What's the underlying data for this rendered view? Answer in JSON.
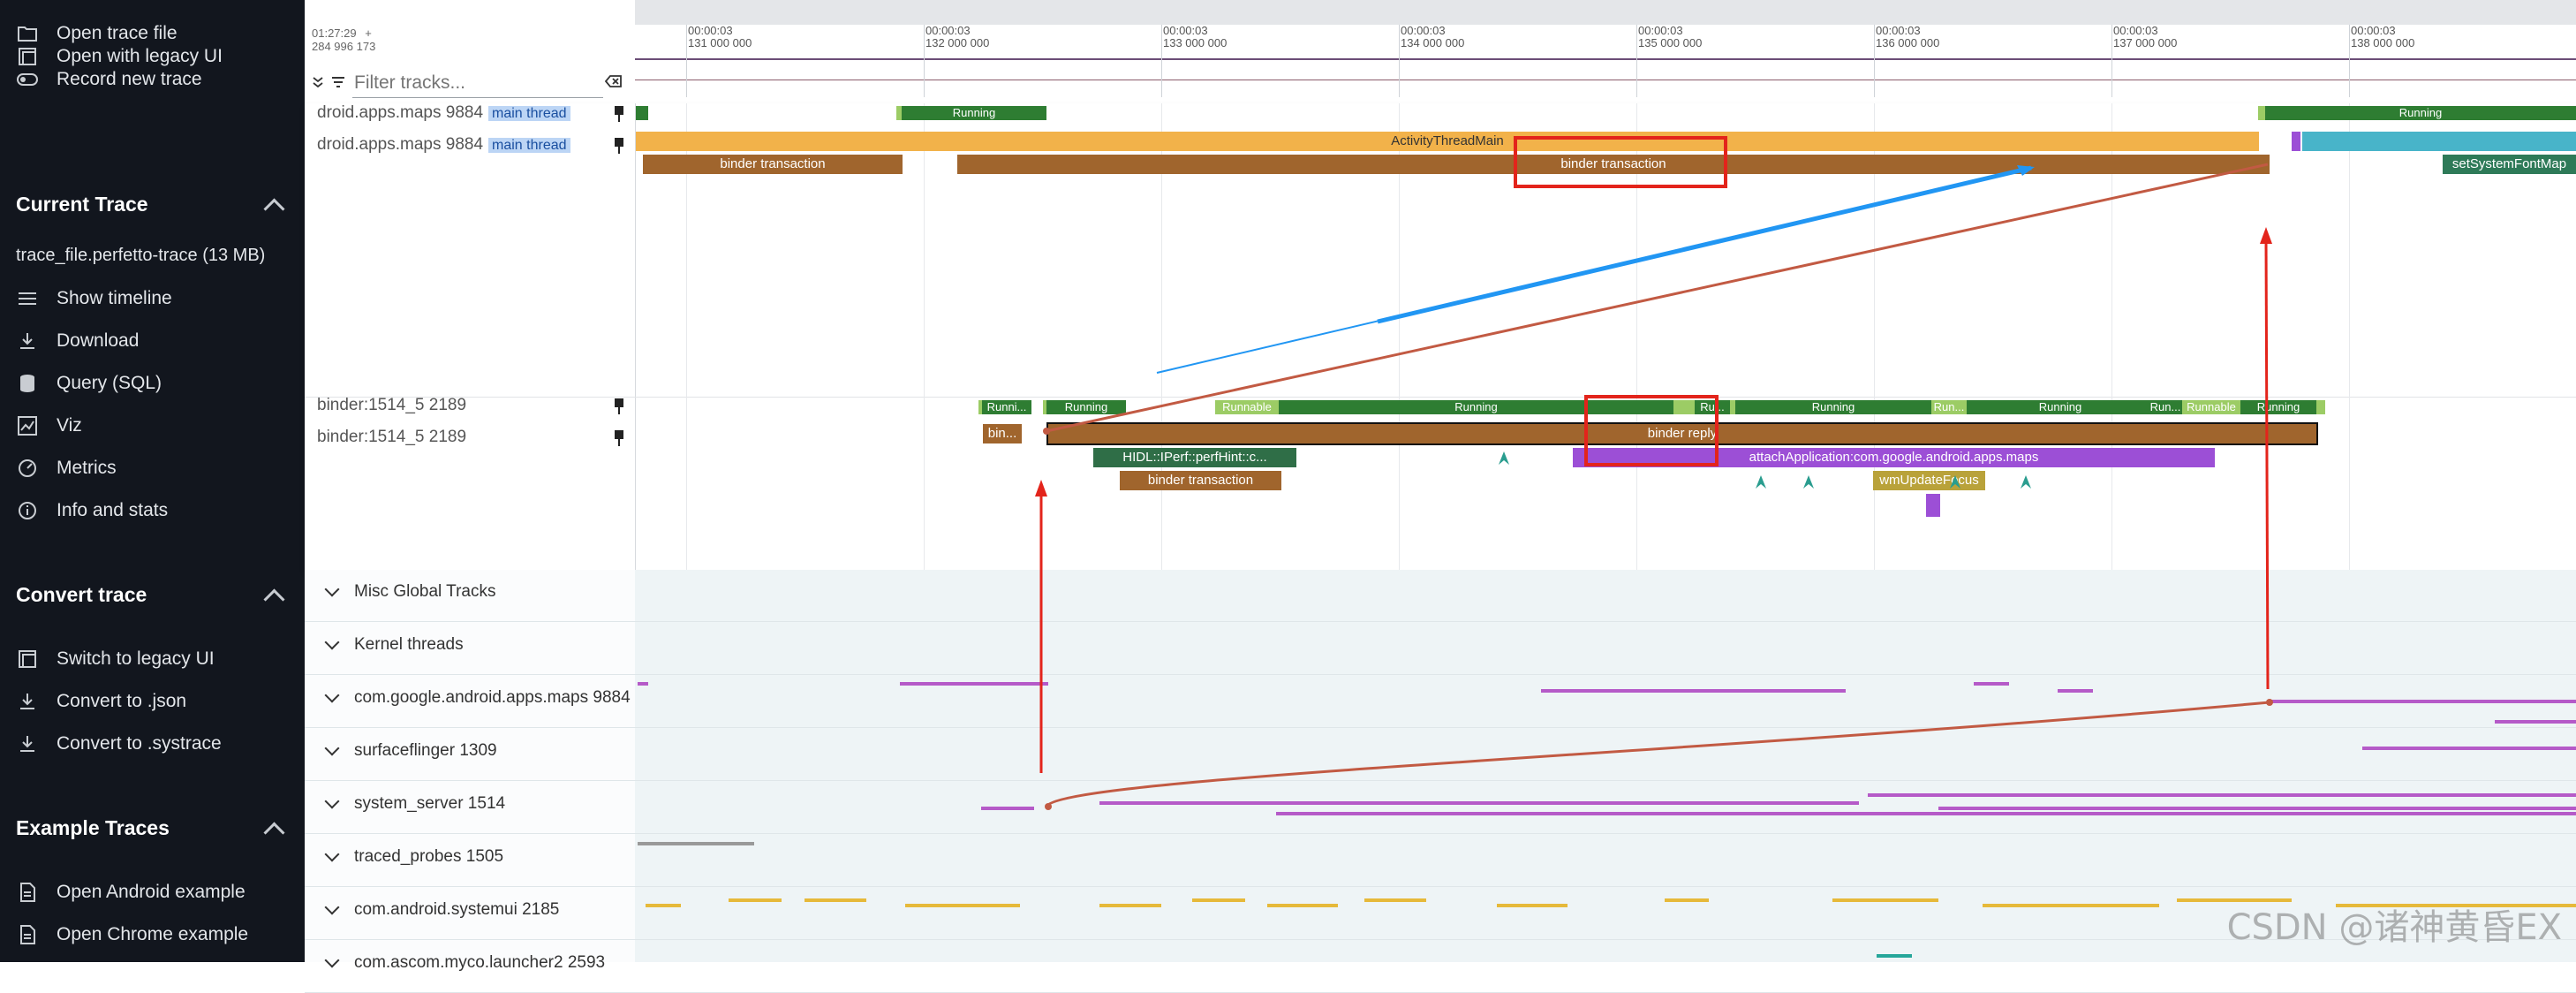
{
  "sidebar": {
    "top_items": [
      {
        "label": "Open trace file",
        "icon": "folder-open-icon"
      },
      {
        "label": "Open with legacy UI",
        "icon": "window-icon"
      },
      {
        "label": "Record new trace",
        "icon": "record-toggle-icon"
      }
    ],
    "current_trace": {
      "heading": "Current Trace",
      "file": "trace_file.perfetto-trace (13 MB)",
      "items": [
        {
          "label": "Show timeline",
          "icon": "timeline-icon"
        },
        {
          "label": "Download",
          "icon": "download-icon"
        },
        {
          "label": "Query (SQL)",
          "icon": "database-icon"
        },
        {
          "label": "Viz",
          "icon": "chart-icon"
        },
        {
          "label": "Metrics",
          "icon": "gauge-icon"
        },
        {
          "label": "Info and stats",
          "icon": "info-icon"
        }
      ]
    },
    "convert_trace": {
      "heading": "Convert trace",
      "items": [
        {
          "label": "Switch to legacy UI",
          "icon": "window-icon"
        },
        {
          "label": "Convert to .json",
          "icon": "download-icon"
        },
        {
          "label": "Convert to .systrace",
          "icon": "download-icon"
        }
      ]
    },
    "example_traces": {
      "heading": "Example Traces",
      "items": [
        {
          "label": "Open Android example",
          "icon": "document-icon"
        },
        {
          "label": "Open Chrome example",
          "icon": "document-icon"
        }
      ]
    }
  },
  "timeline": {
    "origin_time": "01:27:29",
    "origin_ns": "284 996 173",
    "plus": "+",
    "filter_placeholder": "Filter tracks...",
    "ticks": [
      {
        "time": "00:00:03",
        "ns": "131 000 000"
      },
      {
        "time": "00:00:03",
        "ns": "132 000 000"
      },
      {
        "time": "00:00:03",
        "ns": "133 000 000"
      },
      {
        "time": "00:00:03",
        "ns": "134 000 000"
      },
      {
        "time": "00:00:03",
        "ns": "135 000 000"
      },
      {
        "time": "00:00:03",
        "ns": "136 000 000"
      },
      {
        "time": "00:00:03",
        "ns": "137 000 000"
      },
      {
        "time": "00:00:03",
        "ns": "138 000 000"
      }
    ]
  },
  "pinned_tracks": [
    {
      "name": "droid.apps.maps 9884",
      "tag": "main thread"
    },
    {
      "name": "droid.apps.maps 9884",
      "tag": "main thread"
    },
    {
      "name": "binder:1514_5 2189",
      "tag": ""
    },
    {
      "name": "binder:1514_5 2189",
      "tag": ""
    }
  ],
  "slices": {
    "running": "Running",
    "runnable": "Runnable",
    "runni_short": "Runni...",
    "ru_short": "Ru...",
    "run_short": "Run...",
    "activity_thread_main": "ActivityThreadMain",
    "binder_transaction": "binder transaction",
    "set_system_font_map": "setSystemFontMap",
    "bin_short": "bin...",
    "binder_reply": "binder reply",
    "hidl": "HIDL::IPerf::perfHint::c...",
    "attach_application": "attachApplication:com.google.android.apps.maps",
    "wm_update_focus": "wmUpdateFocus"
  },
  "process_list": [
    "Misc Global Tracks",
    "Kernel threads",
    "com.google.android.apps.maps 9884",
    "surfaceflinger 1309",
    "system_server 1514",
    "traced_probes 1505",
    "com.android.systemui 2185",
    "com.ascom.myco.launcher2 2593"
  ],
  "colors": {
    "sidebar_bg": "#12161e",
    "running": "#2e7d32",
    "runnable": "#9ccc65",
    "activity_main": "#f2b24a",
    "binder": "#a0652d",
    "attach": "#9c4fd6",
    "hidl": "#2f6e47",
    "wm_focus": "#b9a23a",
    "font_map": "#2e7a58",
    "flow_blue": "#2196f3",
    "flow_red": "#c25a43",
    "annotation_red": "#e3241b"
  },
  "watermark": "CSDN @诸神黄昏EX"
}
